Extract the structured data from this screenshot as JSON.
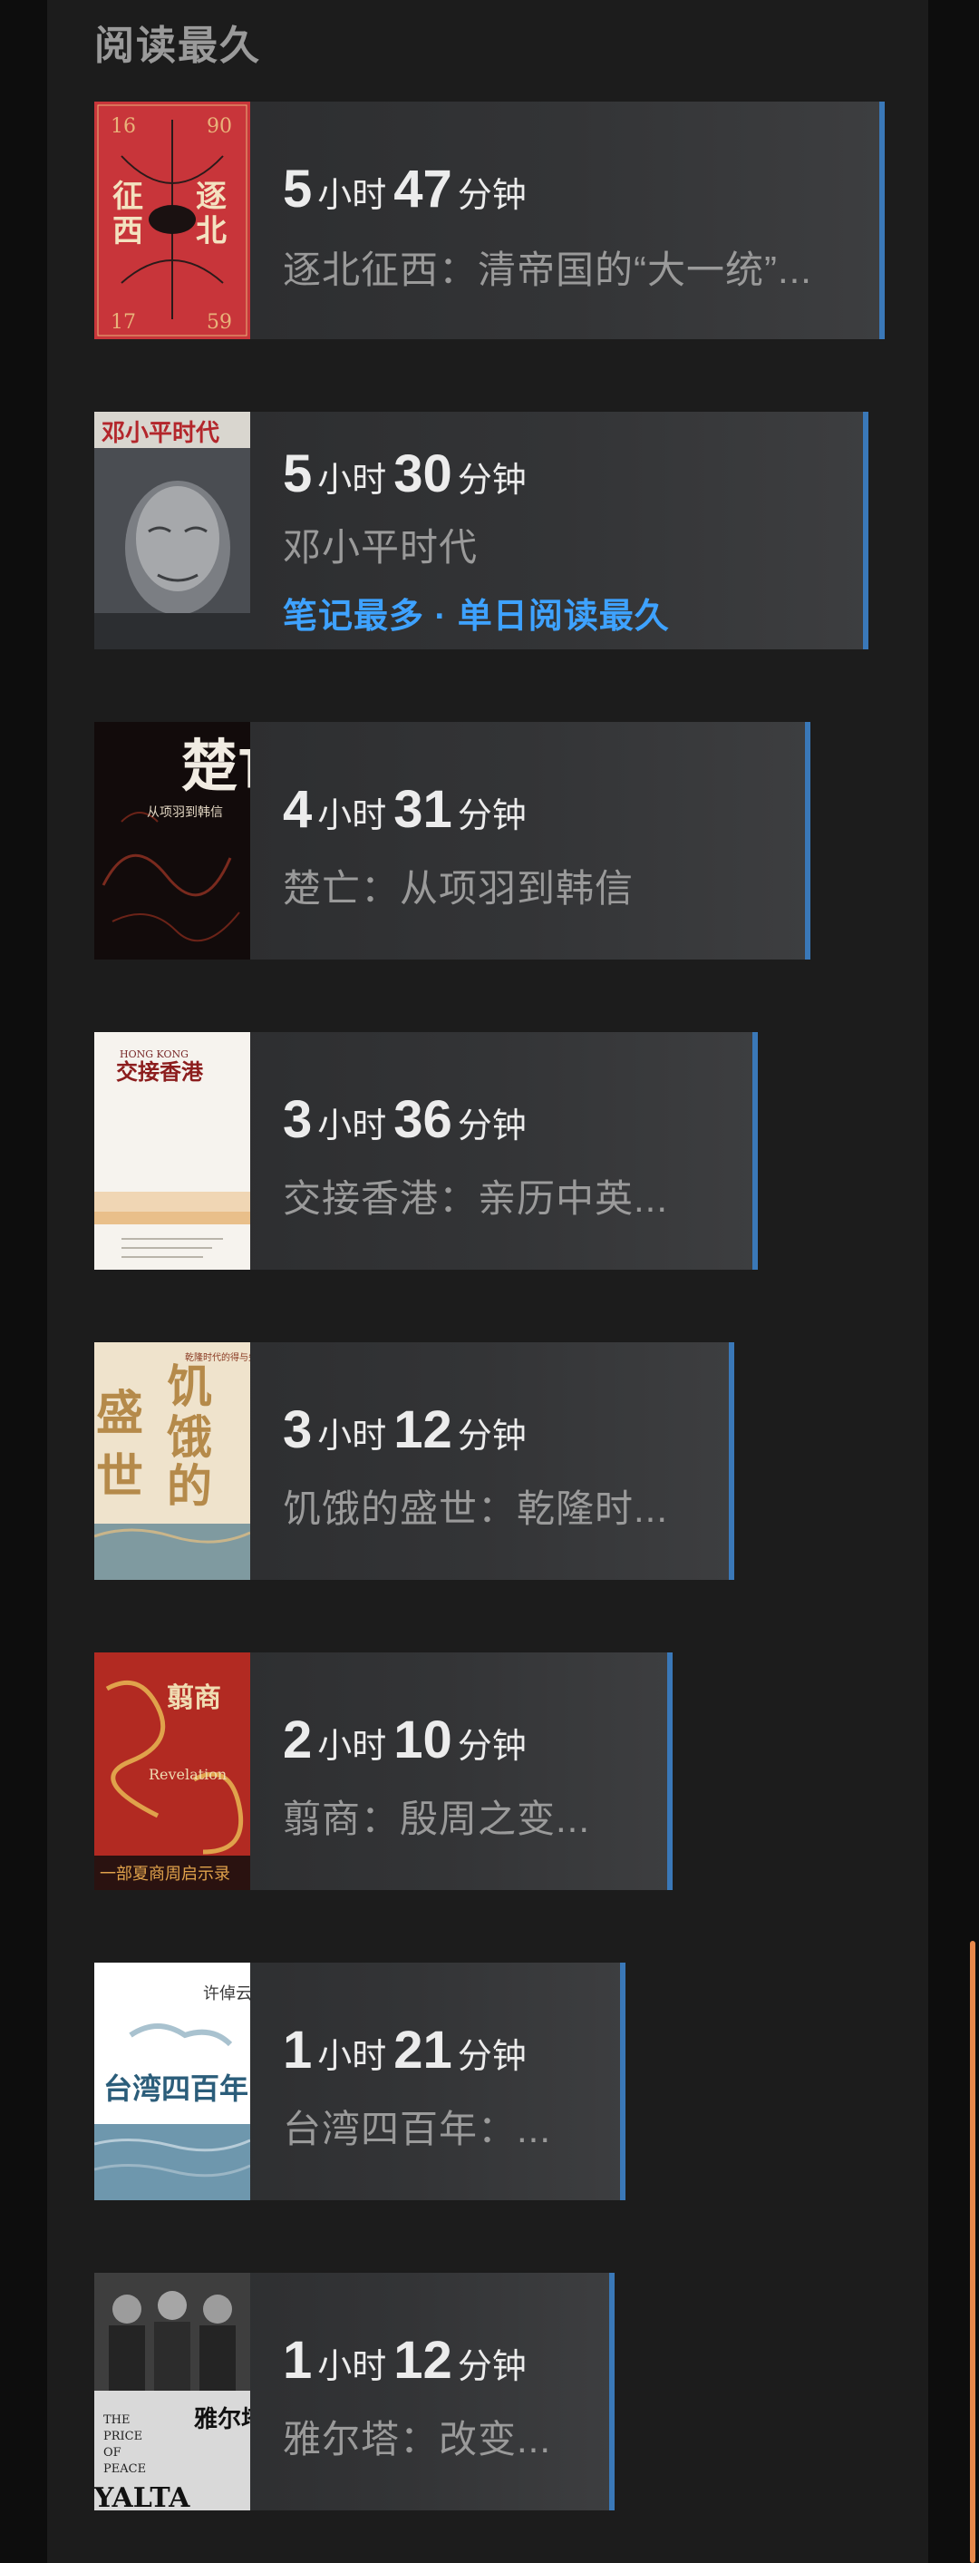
{
  "section": {
    "title": "阅读最久"
  },
  "books": [
    {
      "hours": "5",
      "hours_unit": "小时",
      "minutes": "47",
      "minutes_unit": "分钟",
      "title": "逐北征西：清帝国的“大一统”...",
      "badge": ""
    },
    {
      "hours": "5",
      "hours_unit": "小时",
      "minutes": "30",
      "minutes_unit": "分钟",
      "title": "邓小平时代",
      "badge": "笔记最多 · 单日阅读最久"
    },
    {
      "hours": "4",
      "hours_unit": "小时",
      "minutes": "31",
      "minutes_unit": "分钟",
      "title": "楚亡：从项羽到韩信",
      "badge": ""
    },
    {
      "hours": "3",
      "hours_unit": "小时",
      "minutes": "36",
      "minutes_unit": "分钟",
      "title": "交接香港：亲历中英...",
      "badge": ""
    },
    {
      "hours": "3",
      "hours_unit": "小时",
      "minutes": "12",
      "minutes_unit": "分钟",
      "title": "饥饿的盛世：乾隆时...",
      "badge": ""
    },
    {
      "hours": "2",
      "hours_unit": "小时",
      "minutes": "10",
      "minutes_unit": "分钟",
      "title": "翦商：殷周之变...",
      "badge": ""
    },
    {
      "hours": "1",
      "hours_unit": "小时",
      "minutes": "21",
      "minutes_unit": "分钟",
      "title": "台湾四百年：...",
      "badge": ""
    },
    {
      "hours": "1",
      "hours_unit": "小时",
      "minutes": "12",
      "minutes_unit": "分钟",
      "title": "雅尔塔：改变...",
      "badge": ""
    }
  ],
  "covers": {
    "b0": {
      "chars": [
        "逐",
        "北",
        "征",
        "西"
      ],
      "years": [
        "16",
        "90",
        "17",
        "59"
      ]
    },
    "b1": {
      "chars": "邓小平时代"
    },
    "b2": {
      "chars": "楚亡",
      "sub": "从项羽到韩信"
    },
    "b3": {
      "chars": "交接香港",
      "en": "HONG KONG"
    },
    "b4": {
      "chars": [
        "盛",
        "世",
        "饥",
        "饿",
        "的"
      ],
      "sub": "乾隆时代的得与失"
    },
    "b5": {
      "chars": "翦商",
      "en": "Revelation",
      "sub": "一部夏商周启示录"
    },
    "b6": {
      "chars": "台湾四百年",
      "author": "许倬云"
    },
    "b7": {
      "chars": "雅尔塔",
      "en": [
        "THE",
        "PRICE",
        "OF",
        "PEACE",
        "YALTA"
      ]
    }
  },
  "colors": {
    "accent_bar": "#3a78b8",
    "badge": "#3ea2ff",
    "scroll": "#e8884a"
  }
}
